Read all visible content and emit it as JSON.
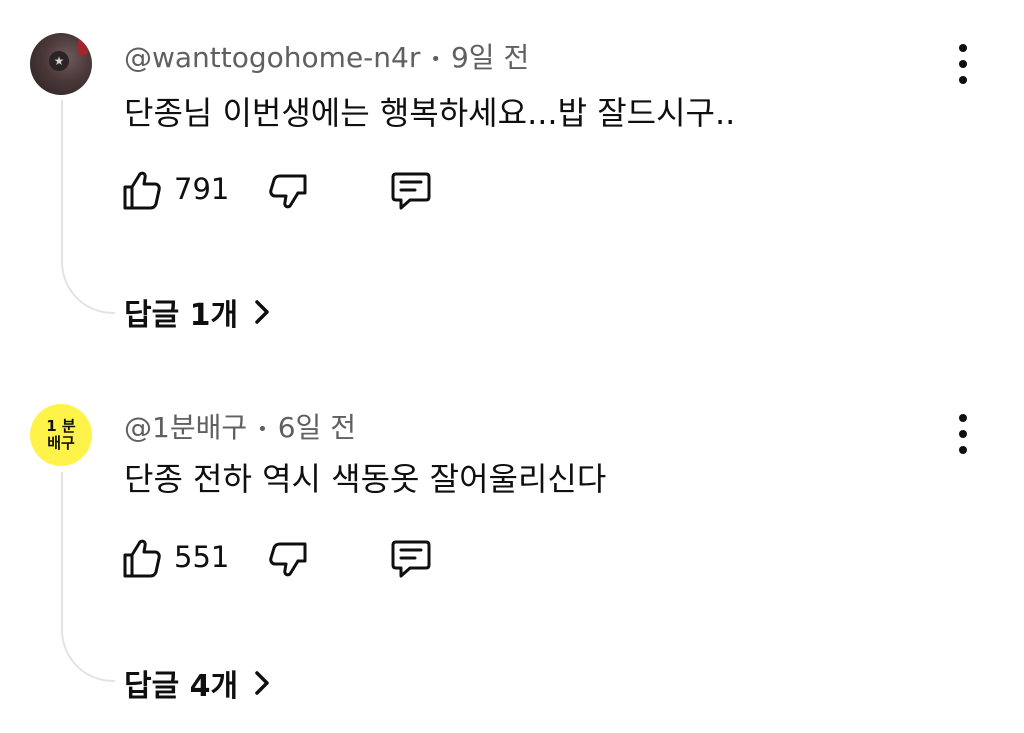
{
  "comments": [
    {
      "handle": "@wanttogohome-n4r",
      "time": "9일 전",
      "text": "단종님 이번생에는 행복하세요...밥 잘드시구..",
      "likes": "791",
      "replies_label": "답글 1개",
      "avatar_icon": "dark-photo-avatar"
    },
    {
      "handle": "@1분배구",
      "time": "6일 전",
      "text": "단종 전하 역시 색동옷 잘어울리신다",
      "likes": "551",
      "replies_label": "답글 4개",
      "avatar_icon": "yellow-text-avatar",
      "avatar_text_line1": "1 분",
      "avatar_text_line2": "배구"
    }
  ],
  "separator": "•",
  "icons": {
    "like": "thumbs-up-icon",
    "dislike": "thumbs-down-icon",
    "reply": "comment-icon",
    "more": "more-vertical-icon",
    "expand": "chevron-right-icon"
  }
}
